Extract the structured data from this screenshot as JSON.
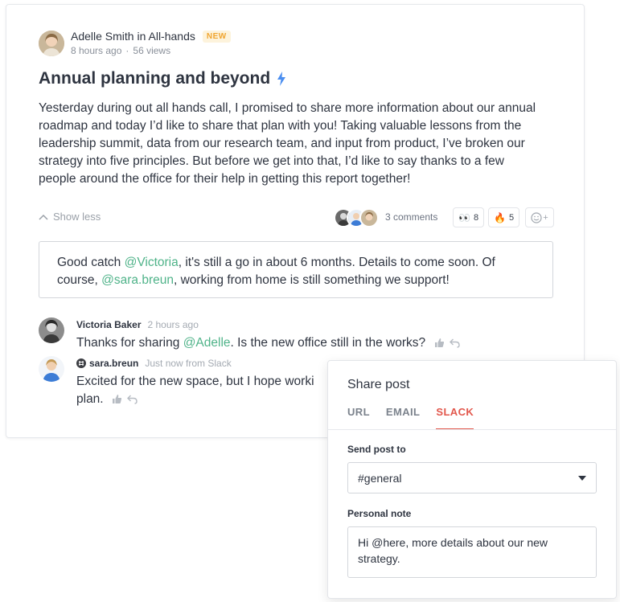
{
  "post": {
    "author_line": "Adelle Smith in All-hands",
    "badge": "NEW",
    "time": "8 hours ago",
    "views": "56 views",
    "title": "Annual planning and beyond",
    "body": "Yesterday during out all hands call, I promised to share more information about our annual roadmap and today I’d like to share that plan with you! Taking valuable lessons from the leadership summit, data from our research team, and input from product, I’ve broken our strategy into five principles. But before we get into that, I’d like to say thanks to a few people around the office for their help in getting this report together!",
    "show_less": "Show less",
    "comments_count": "3 comments",
    "reactions": [
      {
        "emoji": "👀",
        "count": "8"
      },
      {
        "emoji": "🔥",
        "count": "5"
      }
    ],
    "add_reaction": "+"
  },
  "reply": {
    "part1": "Good catch ",
    "mention1": "@Victoria",
    "part2": ", it's still a go in about 6 months. Details to come soon. Of course, ",
    "mention2": "@sara.breun",
    "part3": ", working from home is still something we support!"
  },
  "comments": [
    {
      "name": "Victoria Baker",
      "time": "2 hours ago",
      "text_before": "Thanks for sharing ",
      "mention": "@Adelle",
      "text_after": ". Is the new office still in the works?"
    },
    {
      "name": "sara.breun",
      "time": "Just now from Slack",
      "line1": "Excited for the new space, but I hope worki",
      "line2": "plan."
    }
  ],
  "share": {
    "title": "Share post",
    "tabs": [
      "URL",
      "EMAIL",
      "SLACK"
    ],
    "active_tab": "SLACK",
    "send_label": "Send post to",
    "channel": "#general",
    "note_label": "Personal note",
    "note_value": "Hi @here, more details about our new strategy."
  },
  "colors": {
    "accent_red": "#e2574c",
    "mention_green": "#4fb389",
    "badge_yellow": "#f0a531",
    "bolt_blue": "#4a8ef0"
  }
}
